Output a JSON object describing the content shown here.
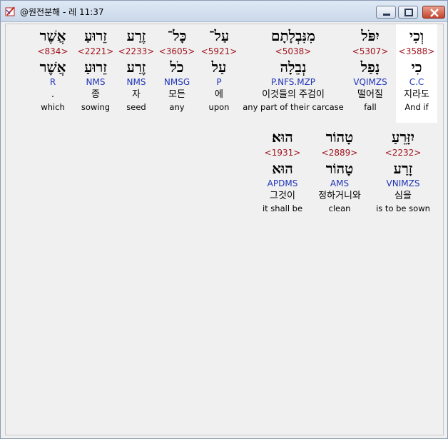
{
  "window": {
    "title": "@원전분해 - 레 11:37"
  },
  "rows": [
    {
      "words": [
        {
          "heb": "וְכִי",
          "strong": "<3588>",
          "lemma": "כִי",
          "parse": "C.C",
          "kor": "지라도",
          "eng": "And if",
          "selected": true
        },
        {
          "heb": "יִפֹּל",
          "strong": "<5307>",
          "lemma": "נָפַל",
          "parse": "VQIMZS",
          "kor": "떨어질",
          "eng": "fall",
          "selected": false
        },
        {
          "heb": "מִנִּבְלָתָם",
          "strong": "<5038>",
          "lemma": "נְבֵלָה",
          "parse": "P.NFS.MZP",
          "kor": "이것들의 주검이",
          "eng": "any part of their carcase",
          "selected": false
        },
        {
          "heb": "עַל־",
          "strong": "<5921>",
          "lemma": "עַל",
          "parse": "P",
          "kor": "에",
          "eng": "upon",
          "selected": false
        },
        {
          "heb": "כָּל־",
          "strong": "<3605>",
          "lemma": "כֹל",
          "parse": "NMSG",
          "kor": "모든",
          "eng": "any",
          "selected": false
        },
        {
          "heb": "זֶרַע",
          "strong": "<2233>",
          "lemma": "זֶרַע",
          "parse": "NMS",
          "kor": "자",
          "eng": "seed",
          "selected": false
        },
        {
          "heb": "זֵרוּעַ",
          "strong": "<2221>",
          "lemma": "זֵרוּעַ",
          "parse": "NMS",
          "kor": "종",
          "eng": "sowing",
          "selected": false
        },
        {
          "heb": "אֲשֶׁר",
          "strong": "<834>",
          "lemma": "אֲשֶׁר",
          "parse": "R",
          "kor": ".",
          "eng": "which",
          "selected": false
        }
      ]
    },
    {
      "words": [
        {
          "heb": "יִזָּרֵעַ",
          "strong": "<2232>",
          "lemma": "זָרַע",
          "parse": "VNIMZS",
          "kor": "심을",
          "eng": "is to be sown",
          "selected": false
        },
        {
          "heb": "טָהוֹר",
          "strong": "<2889>",
          "lemma": "טָהוֹר",
          "parse": "AMS",
          "kor": "정하거니와",
          "eng": "clean",
          "selected": false
        },
        {
          "heb": "הוּא׃",
          "strong": "<1931>",
          "lemma": "הוּא",
          "parse": "APDMS",
          "kor": "그것이",
          "eng": "it shall be",
          "selected": false
        }
      ]
    }
  ]
}
